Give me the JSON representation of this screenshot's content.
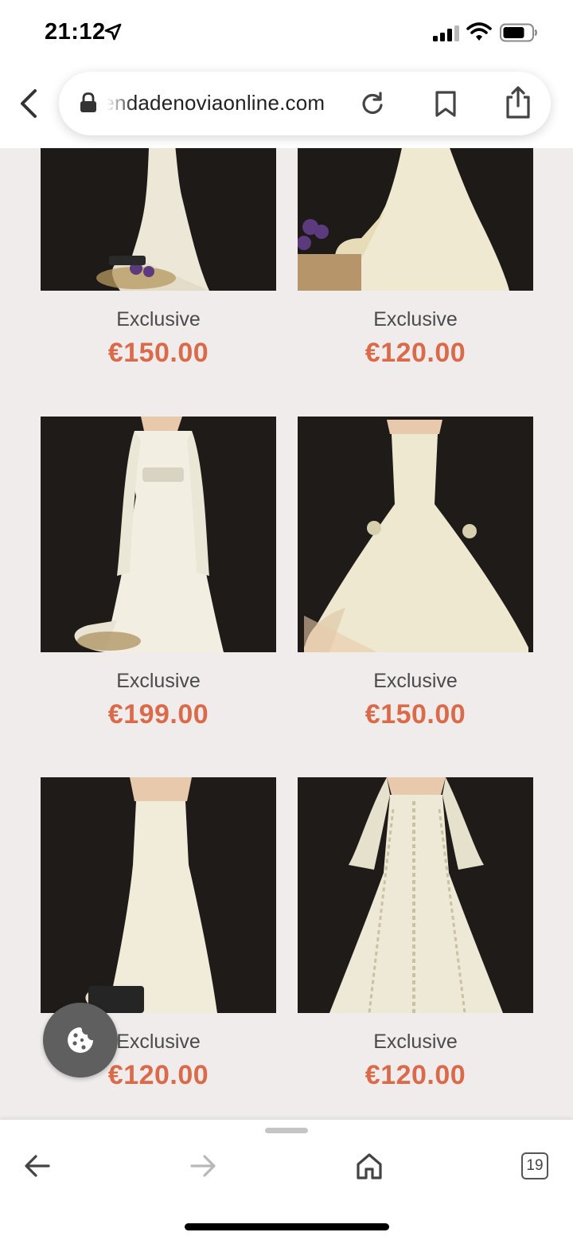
{
  "status": {
    "time": "21:12"
  },
  "browser": {
    "url": "tiendadenoviaonline.com",
    "tab_count": "19"
  },
  "products": [
    {
      "name": "Exclusive",
      "price": "€150.00"
    },
    {
      "name": "Exclusive",
      "price": "€120.00"
    },
    {
      "name": "Exclusive",
      "price": "€199.00"
    },
    {
      "name": "Exclusive",
      "price": "€150.00"
    },
    {
      "name": "Exclusive",
      "price": "€120.00"
    },
    {
      "name": "Exclusive",
      "price": "€120.00"
    }
  ],
  "colors": {
    "price": "#d96b4b",
    "page_background": "#f1ecec",
    "photo_background": "#1c1816",
    "dress": "#efeada"
  },
  "icons": [
    "location-arrow-icon",
    "signal-icon",
    "wifi-icon",
    "battery-icon",
    "chevron-left-icon",
    "lock-icon",
    "reload-icon",
    "bookmark-icon",
    "share-icon",
    "cookie-icon",
    "arrow-left-icon",
    "arrow-right-icon",
    "home-icon"
  ]
}
